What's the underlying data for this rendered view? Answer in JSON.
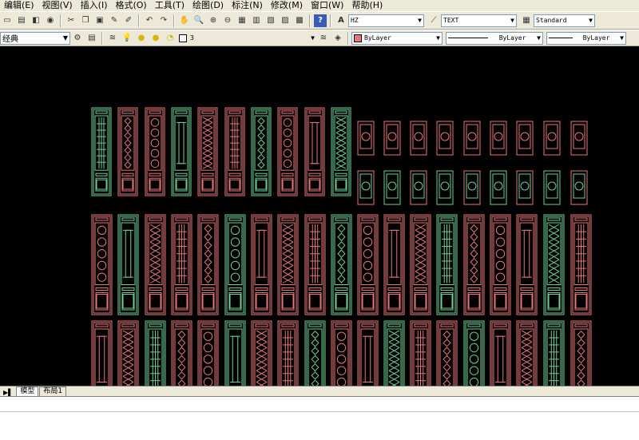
{
  "menu": [
    "编辑(E)",
    "视图(V)",
    "插入(I)",
    "格式(O)",
    "工具(T)",
    "绘图(D)",
    "标注(N)",
    "修改(M)",
    "窗口(W)",
    "帮助(H)"
  ],
  "toolbar": {
    "text_style": "HZ",
    "dim_style": "TEXT",
    "table_style": "Standard",
    "layer_left": "经典",
    "layer_name": "3",
    "color": "ByLayer",
    "linetype": "ByLayer",
    "lineweight": "ByLayer"
  },
  "tabs": [
    "模型",
    "布局1"
  ],
  "colors": {
    "pink": "#e8767a",
    "green": "#6fcf97",
    "canvas": "#000000",
    "accent": "#ff2020"
  }
}
